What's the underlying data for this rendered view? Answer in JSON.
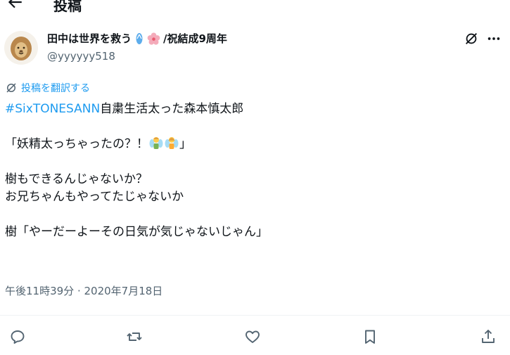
{
  "header": {
    "title": "投稿"
  },
  "author": {
    "name_prefix": "田中は世界を救う",
    "name_suffix": "/祝結成9周年",
    "handle": "@yyyyyy518",
    "avatar_icon": "lion-icon",
    "name_emojis": [
      "flip-flop-icon",
      "cherry-blossom-icon"
    ]
  },
  "translate_label": "投稿を翻訳する",
  "tweet": {
    "hashtag": "#SixTONESANN",
    "line1_rest": "自粛生活太った森本慎太郎",
    "line3_open": "「妖精太っちゃったの？！",
    "line3_close": "」",
    "line5": "樹もできるんじゃないか？",
    "line6": "お兄ちゃんもやってたじゃないか",
    "line8": "樹「やーだーよーその日気が気じゃないじゃん」",
    "fairy_emojis": [
      "fairy-man-icon",
      "fairy-woman-icon"
    ]
  },
  "timestamp": "午後11時39分 · 2020年7月18日",
  "actions": [
    "reply-icon",
    "repost-icon",
    "like-icon",
    "bookmark-icon",
    "share-icon"
  ],
  "colors": {
    "accent": "#1d9bf0",
    "text": "#0f1419",
    "secondary": "#536471"
  }
}
